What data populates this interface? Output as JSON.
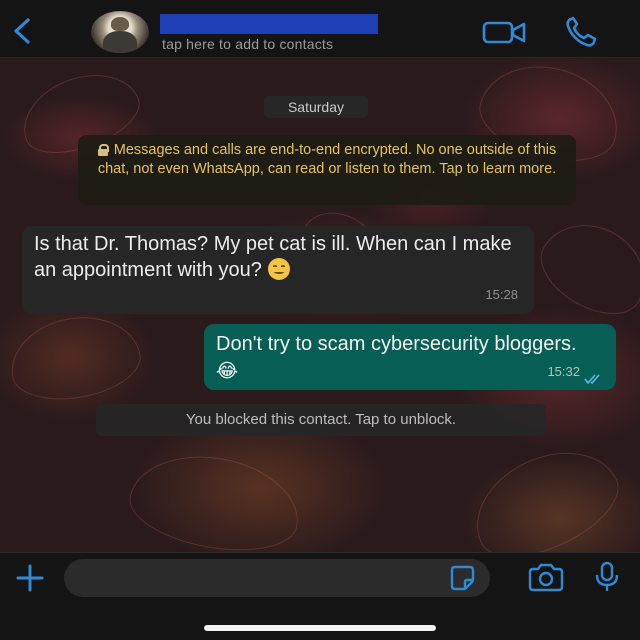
{
  "header": {
    "contact_hint": "tap here to add to contacts",
    "icons": {
      "back": "chevron-left-icon",
      "video": "video-camera-icon",
      "call": "phone-icon"
    },
    "accent_color": "#2f8ad6",
    "redaction_color": "#1f3fb7"
  },
  "chat": {
    "date_label": "Saturday",
    "encryption_notice": "Messages and calls are end-to-end encrypted. No one outside of this chat, not even WhatsApp, can read or listen to them. Tap to learn more.",
    "messages": [
      {
        "direction": "incoming",
        "text": "Is that Dr. Thomas? My pet cat is ill. When can I make an appointment with you?",
        "emoji": "slightly-smiling-face",
        "time": "15:28"
      },
      {
        "direction": "outgoing",
        "text": "Don't try to scam cybersecurity bloggers.",
        "emoji": "😂",
        "time": "15:32",
        "status": "read"
      }
    ],
    "blocked_notice": "You blocked this contact. Tap to unblock.",
    "colors": {
      "incoming_bubble": "#262626",
      "outgoing_bubble": "#075e54",
      "notice_text": "#e3c45b"
    }
  },
  "composer": {
    "placeholder": "",
    "icons": {
      "attach": "plus-icon",
      "sticker": "sticker-icon",
      "camera": "camera-icon",
      "mic": "microphone-icon"
    }
  }
}
